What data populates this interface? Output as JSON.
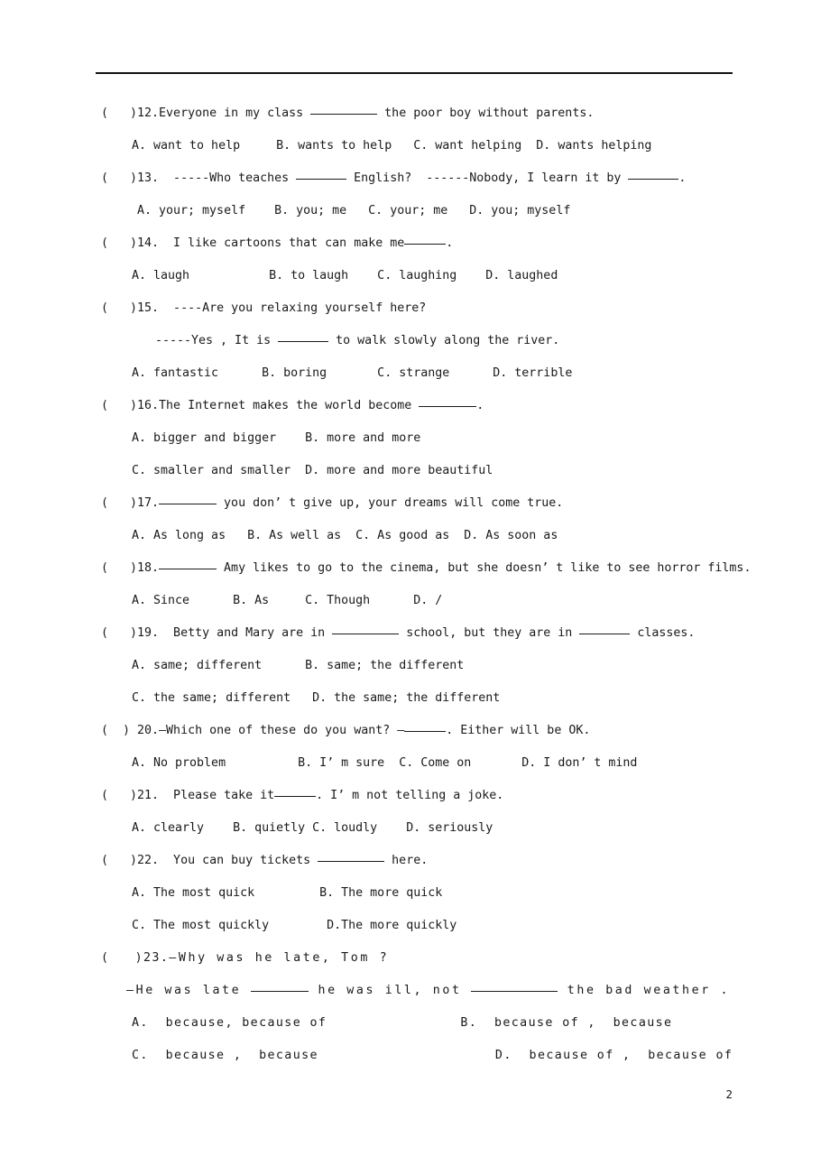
{
  "document": {
    "page_number": "2",
    "questions": [
      {
        "id": "q12",
        "marker": "(   )12.",
        "stem_before": "Everyone in my class ",
        "stem_after": " the poor boy without parents.",
        "options_line1": "A. want to help     B. wants to help   C. want helping  D. wants helping"
      },
      {
        "id": "q13",
        "marker": "(   )13.",
        "stem_before": "  -----Who teaches ",
        "stem_mid": " English?  ------Nobody, I learn it by ",
        "stem_after": ".",
        "options_line1": "A. your; myself    B. you; me   C. your; me   D. you; myself"
      },
      {
        "id": "q14",
        "marker": "(   )14.",
        "stem_before": "  I like cartoons that can make me",
        "stem_after": ".",
        "options_line1": "A. laugh           B. to laugh    C. laughing    D. laughed"
      },
      {
        "id": "q15",
        "marker": "(   )15.",
        "stem_before": "  ----Are you relaxing yourself here?",
        "stem_cont_before": "-----Yes , It is ",
        "stem_cont_after": " to walk slowly along the river.",
        "options_line1": "A. fantastic      B. boring       C. strange      D. terrible"
      },
      {
        "id": "q16",
        "marker": "(   )16.",
        "stem_before": "The Internet makes the world become ",
        "stem_after": ".",
        "options_line1": "A. bigger and bigger    B. more and more",
        "options_line2": "C. smaller and smaller  D. more and more beautiful"
      },
      {
        "id": "q17",
        "marker": "(   )17.",
        "stem_before": "",
        "stem_after": " you don’ t give up, your dreams will come true.",
        "options_line1": "A. As long as   B. As well as  C. As good as  D. As soon as"
      },
      {
        "id": "q18",
        "marker": "(   )18.",
        "stem_before": "",
        "stem_after": " Amy likes to go to the cinema, but she doesn’ t like to see horror films.",
        "options_line1": "A. Since      B. As     C. Though      D. /"
      },
      {
        "id": "q19",
        "marker": "(   )19.",
        "stem_before": "  Betty and Mary are in ",
        "stem_mid": " school, but they are in ",
        "stem_after": " classes.",
        "options_line1": "A. same; different      B. same; the different",
        "options_line2": "C. the same; different   D. the same; the different"
      },
      {
        "id": "q20",
        "marker": "(  ) 20.",
        "stem_before": "—Which one of these do you want? —",
        "stem_after": ". Either will be OK.",
        "options_line1": "A. No problem          B. I’ m sure  C. Come on       D. I don’ t mind"
      },
      {
        "id": "q21",
        "marker": "(   )21.",
        "stem_before": "  Please take it",
        "stem_after": ". I’ m not telling a joke.",
        "options_line1": "A. clearly    B. quietly C. loudly    D. seriously"
      },
      {
        "id": "q22",
        "marker": "(   )22.",
        "stem_before": "  You can buy tickets ",
        "stem_after": " here.",
        "options_line1": "A. The most quick         B. The more quick",
        "options_line2": "C. The most quickly        D.The more quickly"
      },
      {
        "id": "q23",
        "marker": "(   )23.",
        "stem_before": "—Why was he late, Tom ?",
        "stem_cont_before": "—He was late ",
        "stem_cont_mid": " he was ill, not ",
        "stem_cont_after": " the bad weather .",
        "options_line1_a": "A.  because, because of",
        "options_line1_b": "B.  because of ,  because",
        "options_line2_c": "C.  because ,  because",
        "options_line2_d": "D.  because of ,  because of"
      }
    ]
  }
}
